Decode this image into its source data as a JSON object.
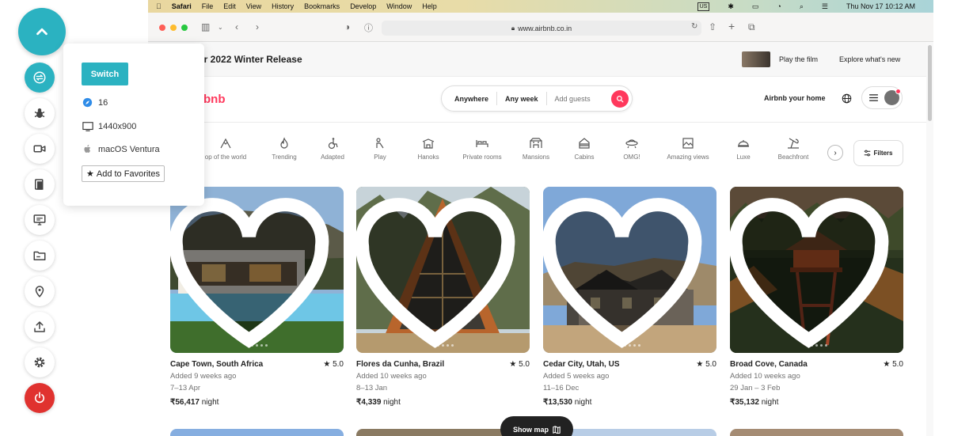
{
  "menubar": {
    "app": "Safari",
    "items": [
      "File",
      "Edit",
      "View",
      "History",
      "Bookmarks",
      "Develop",
      "Window",
      "Help"
    ],
    "input_source": "US",
    "datetime": "Thu Nov 17  10:12 AM"
  },
  "toolbar": {
    "url": "www.airbnb.co.in"
  },
  "popover": {
    "switch_label": "Switch",
    "browser_version": "16",
    "resolution": "1440x900",
    "os": "macOS Ventura",
    "favorites_label": "Add to Favorites"
  },
  "banner": {
    "text": "cing our 2022 Winter Release",
    "play_label": "Play the film",
    "explore_label": "Explore what's new"
  },
  "header": {
    "logo": "bnb",
    "search": {
      "anywhere": "Anywhere",
      "any_week": "Any week",
      "add_guests": "Add guests"
    },
    "host_link": "Airbnb your home"
  },
  "categories": [
    {
      "label": "op of the world",
      "icon": "peak-icon"
    },
    {
      "label": "Trending",
      "icon": "flame-icon"
    },
    {
      "label": "Adapted",
      "icon": "wheelchair-icon"
    },
    {
      "label": "Play",
      "icon": "slide-icon"
    },
    {
      "label": "Hanoks",
      "icon": "hanok-icon"
    },
    {
      "label": "Private rooms",
      "icon": "bed-icon"
    },
    {
      "label": "Mansions",
      "icon": "mansion-icon"
    },
    {
      "label": "Cabins",
      "icon": "cabin-icon"
    },
    {
      "label": "OMG!",
      "icon": "ufo-icon"
    },
    {
      "label": "Amazing views",
      "icon": "view-icon"
    },
    {
      "label": "Luxe",
      "icon": "luxe-icon"
    },
    {
      "label": "Beachfront",
      "icon": "beach-icon"
    }
  ],
  "filters_label": "Filters",
  "listings": [
    {
      "title": "Cape Town, South Africa",
      "rating": "5.0",
      "added": "Added 9 weeks ago",
      "dates": "7–13 Apr",
      "price": "₹56,417",
      "unit": " night"
    },
    {
      "title": "Flores da Cunha, Brazil",
      "rating": "5.0",
      "added": "Added 10 weeks ago",
      "dates": "8–13 Jan",
      "price": "₹4,339",
      "unit": " night"
    },
    {
      "title": "Cedar City, Utah, US",
      "rating": "5.0",
      "added": "Added 5 weeks ago",
      "dates": "11–16 Dec",
      "price": "₹13,530",
      "unit": " night"
    },
    {
      "title": "Broad Cove, Canada",
      "rating": "5.0",
      "added": "Added 10 weeks ago",
      "dates": "29 Jan – 3 Feb",
      "price": "₹35,132",
      "unit": " night"
    }
  ],
  "show_map_label": "Show map",
  "colors": {
    "accent": "#2bb2c1",
    "brand": "#ff385c",
    "power": "#e0322f"
  }
}
